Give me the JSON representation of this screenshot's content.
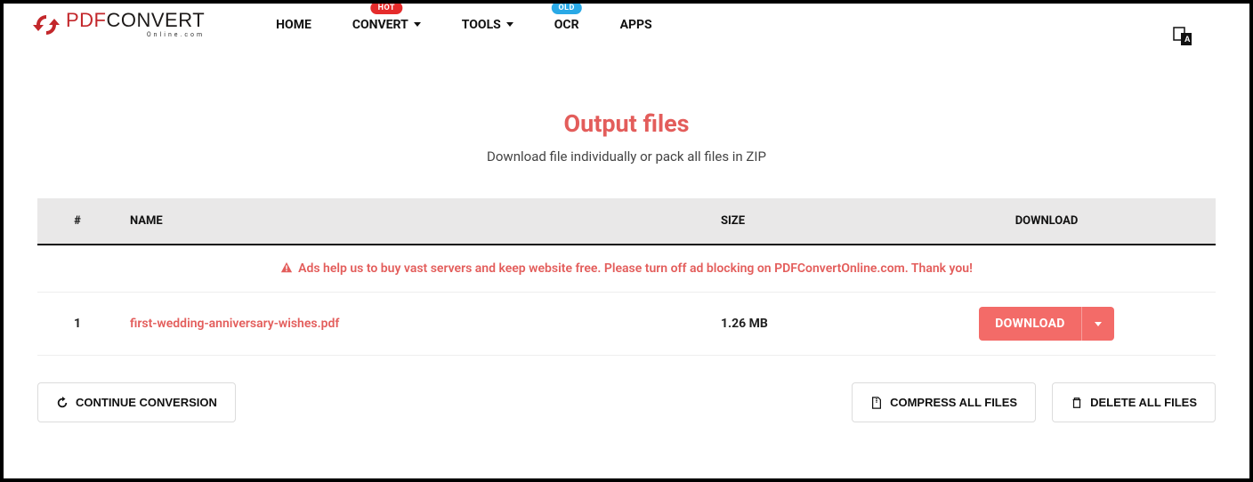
{
  "logo": {
    "pdf": "PDF",
    "convert": "CONVERT",
    "sub": "Online.com"
  },
  "nav": {
    "home": "HOME",
    "convert": "CONVERT",
    "convert_badge": "HOT",
    "tools": "TOOLS",
    "ocr": "OCR",
    "ocr_badge": "OLD",
    "apps": "APPS"
  },
  "section": {
    "title": "Output files",
    "subtitle": "Download file individually or pack all files in ZIP"
  },
  "table": {
    "headers": {
      "idx": "#",
      "name": "NAME",
      "size": "SIZE",
      "download": "DOWNLOAD"
    },
    "ad_text": "Ads help us to buy vast servers and keep website free. Please turn off ad blocking on PDFConvertOnline.com. Thank you!",
    "rows": [
      {
        "idx": "1",
        "name": "first-wedding-anniversary-wishes.pdf",
        "size": "1.26 MB",
        "download_label": "DOWNLOAD"
      }
    ]
  },
  "actions": {
    "continue": "CONTINUE CONVERSION",
    "compress": "COMPRESS ALL FILES",
    "delete": "DELETE ALL FILES"
  }
}
